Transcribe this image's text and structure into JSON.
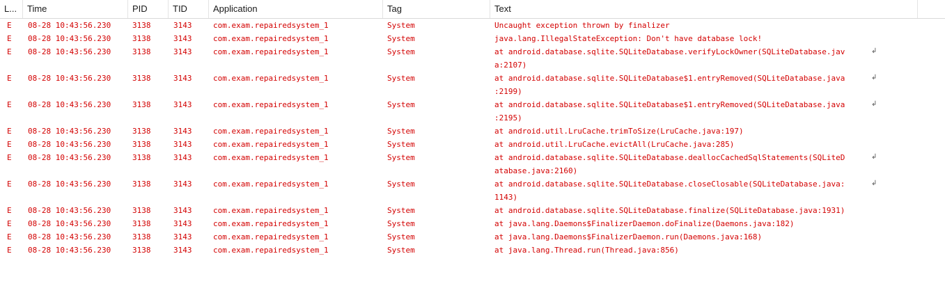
{
  "columns": {
    "level": "L...",
    "time": "Time",
    "pid": "PID",
    "tid": "TID",
    "application": "Application",
    "tag": "Tag",
    "text": "Text"
  },
  "colors": {
    "error": "#d30000",
    "header_text": "#1a1a1a",
    "grid": "#d9d9d9"
  },
  "wrap_icon": "soft-wrap-icon",
  "rows": [
    {
      "level": "E",
      "time": "08-28 10:43:56.230",
      "pid": "3138",
      "tid": "3143",
      "app": "com.exam.repairedsystem_1",
      "tag": "System",
      "text": [
        "Uncaught exception thrown by finalizer"
      ]
    },
    {
      "level": "E",
      "time": "08-28 10:43:56.230",
      "pid": "3138",
      "tid": "3143",
      "app": "com.exam.repairedsystem_1",
      "tag": "System",
      "text": [
        "java.lang.IllegalStateException: Don't have database lock!"
      ]
    },
    {
      "level": "E",
      "time": "08-28 10:43:56.230",
      "pid": "3138",
      "tid": "3143",
      "app": "com.exam.repairedsystem_1",
      "tag": "System",
      "text": [
        "at android.database.sqlite.SQLiteDatabase.verifyLockOwner(SQLiteDatabase.jav",
        "a:2107)"
      ]
    },
    {
      "level": "E",
      "time": "08-28 10:43:56.230",
      "pid": "3138",
      "tid": "3143",
      "app": "com.exam.repairedsystem_1",
      "tag": "System",
      "text": [
        "at android.database.sqlite.SQLiteDatabase$1.entryRemoved(SQLiteDatabase.java",
        ":2199)"
      ]
    },
    {
      "level": "E",
      "time": "08-28 10:43:56.230",
      "pid": "3138",
      "tid": "3143",
      "app": "com.exam.repairedsystem_1",
      "tag": "System",
      "text": [
        "at android.database.sqlite.SQLiteDatabase$1.entryRemoved(SQLiteDatabase.java",
        ":2195)"
      ]
    },
    {
      "level": "E",
      "time": "08-28 10:43:56.230",
      "pid": "3138",
      "tid": "3143",
      "app": "com.exam.repairedsystem_1",
      "tag": "System",
      "text": [
        "at android.util.LruCache.trimToSize(LruCache.java:197)"
      ]
    },
    {
      "level": "E",
      "time": "08-28 10:43:56.230",
      "pid": "3138",
      "tid": "3143",
      "app": "com.exam.repairedsystem_1",
      "tag": "System",
      "text": [
        "at android.util.LruCache.evictAll(LruCache.java:285)"
      ]
    },
    {
      "level": "E",
      "time": "08-28 10:43:56.230",
      "pid": "3138",
      "tid": "3143",
      "app": "com.exam.repairedsystem_1",
      "tag": "System",
      "text": [
        "at android.database.sqlite.SQLiteDatabase.deallocCachedSqlStatements(SQLiteD",
        "atabase.java:2160)"
      ]
    },
    {
      "level": "E",
      "time": "08-28 10:43:56.230",
      "pid": "3138",
      "tid": "3143",
      "app": "com.exam.repairedsystem_1",
      "tag": "System",
      "text": [
        "at android.database.sqlite.SQLiteDatabase.closeClosable(SQLiteDatabase.java:",
        "1143)"
      ]
    },
    {
      "level": "E",
      "time": "08-28 10:43:56.230",
      "pid": "3138",
      "tid": "3143",
      "app": "com.exam.repairedsystem_1",
      "tag": "System",
      "text": [
        "at android.database.sqlite.SQLiteDatabase.finalize(SQLiteDatabase.java:1931)"
      ]
    },
    {
      "level": "E",
      "time": "08-28 10:43:56.230",
      "pid": "3138",
      "tid": "3143",
      "app": "com.exam.repairedsystem_1",
      "tag": "System",
      "text": [
        "at java.lang.Daemons$FinalizerDaemon.doFinalize(Daemons.java:182)"
      ]
    },
    {
      "level": "E",
      "time": "08-28 10:43:56.230",
      "pid": "3138",
      "tid": "3143",
      "app": "com.exam.repairedsystem_1",
      "tag": "System",
      "text": [
        "at java.lang.Daemons$FinalizerDaemon.run(Daemons.java:168)"
      ]
    },
    {
      "level": "E",
      "time": "08-28 10:43:56.230",
      "pid": "3138",
      "tid": "3143",
      "app": "com.exam.repairedsystem_1",
      "tag": "System",
      "text": [
        "at java.lang.Thread.run(Thread.java:856)"
      ]
    }
  ]
}
